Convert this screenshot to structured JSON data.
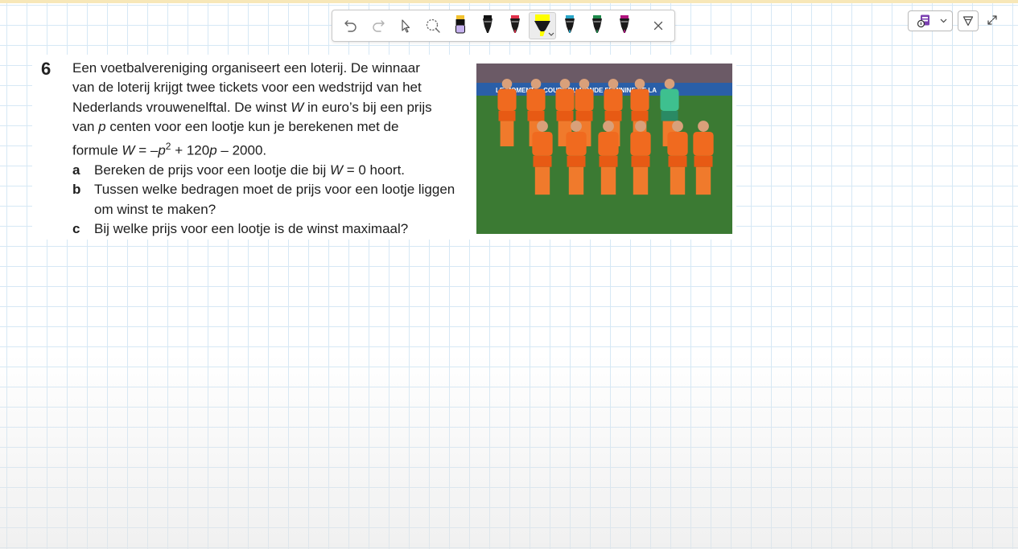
{
  "toolbar": {
    "tools": [
      {
        "name": "undo",
        "icon": "undo-icon"
      },
      {
        "name": "redo",
        "icon": "redo-icon"
      },
      {
        "name": "select",
        "icon": "lasso-select-icon"
      },
      {
        "name": "eraser",
        "icon": "eraser-icon"
      },
      {
        "name": "pen-black-purple",
        "icon": "pen-icon",
        "color": "#b59be6"
      },
      {
        "name": "pen-black",
        "icon": "pen-icon",
        "color": "#1a1a1a"
      },
      {
        "name": "pen-red",
        "icon": "pen-icon",
        "color": "#e0304a"
      },
      {
        "name": "highlighter-yellow",
        "icon": "highlighter-icon",
        "color": "#ffff00",
        "selected": true
      },
      {
        "name": "pen-cyan",
        "icon": "pen-icon",
        "color": "#2aa6c8"
      },
      {
        "name": "pen-green",
        "icon": "pen-icon",
        "color": "#1f8a4c"
      },
      {
        "name": "pen-magenta",
        "icon": "pen-icon",
        "color": "#b0137e"
      },
      {
        "name": "close",
        "icon": "close-icon"
      }
    ]
  },
  "top_right": {
    "account_icon": "onenote-account-icon",
    "filter_icon": "filter-icon",
    "expand_icon": "expand-icon"
  },
  "exercise": {
    "number": "6",
    "intro_lines": [
      "Een voetbalvereniging organiseert een loterij. De winnaar",
      "van de loterij krijgt twee tickets voor een wedstrijd van het",
      "Nederlands vrouwenelftal. De winst ",
      "W",
      " in euro’s bij een prijs",
      "van ",
      "p",
      " centen voor een lootje kun je berekenen met de",
      "formule ",
      "W",
      " = –",
      "p",
      "2",
      " + 120",
      "p",
      " – 2000."
    ],
    "questions": [
      {
        "letter": "a",
        "parts": [
          "Bereken de prijs voor een lootje die bij ",
          "W",
          " = 0 hoort."
        ]
      },
      {
        "letter": "b",
        "parts": [
          "Tussen welke bedragen moet de prijs voor een lootje liggen om winst te maken?"
        ]
      },
      {
        "letter": "c",
        "parts": [
          "Bij welke prijs voor een lootje is de winst maximaal?"
        ]
      }
    ],
    "photo_banner_text": "LE MOMENT ... COUPE DU MONDE FÉMININE DE LA"
  },
  "colors": {
    "grid": "#d6e8f5",
    "jersey": "#f06a1f",
    "pitch": "#3b7a33"
  }
}
